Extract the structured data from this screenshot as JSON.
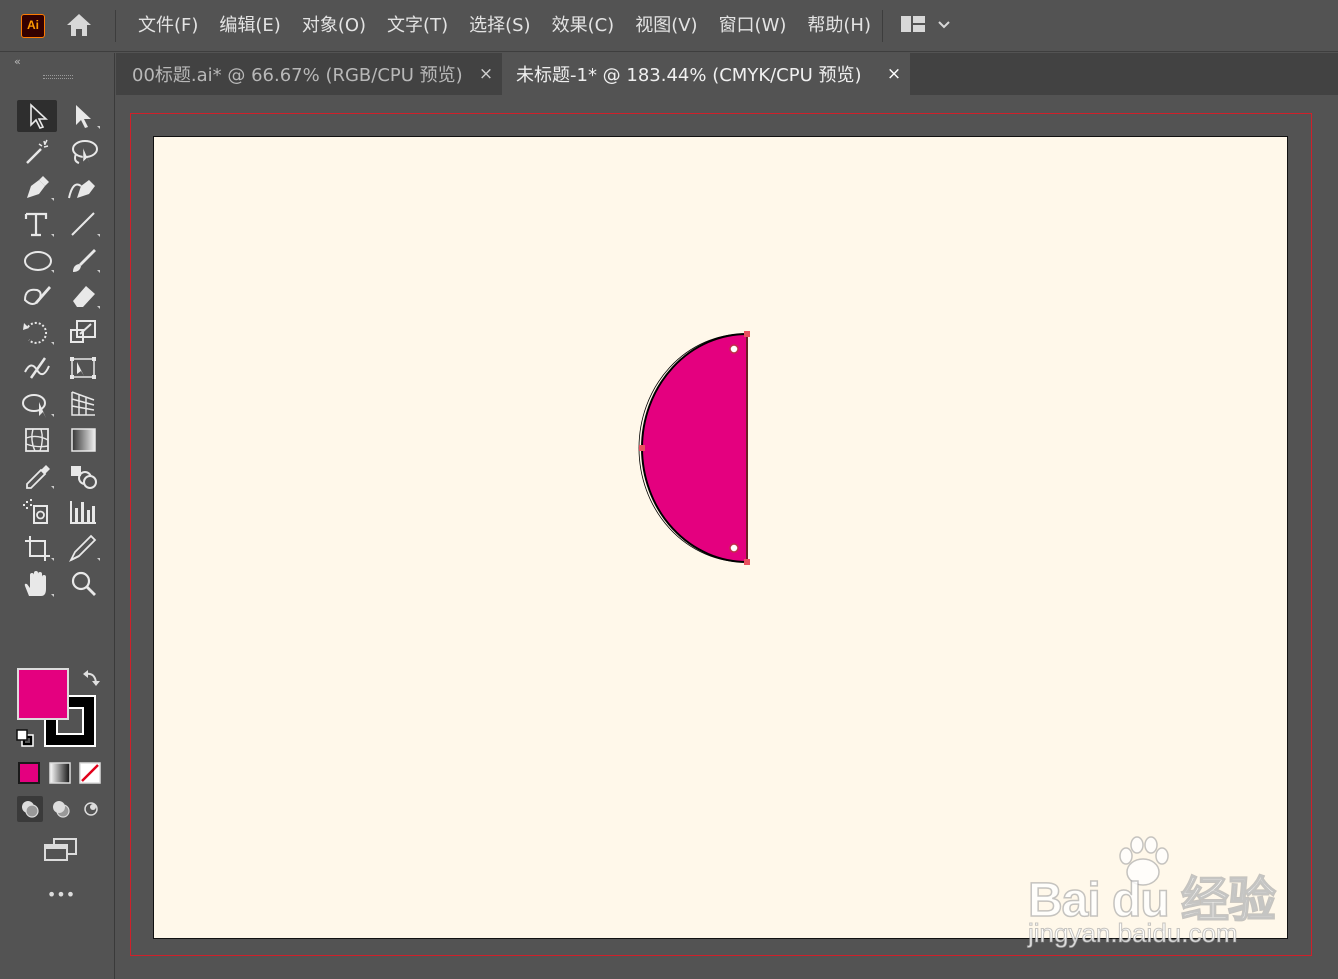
{
  "app": {
    "logo_text": "Ai",
    "menu": [
      "文件(F)",
      "编辑(E)",
      "对象(O)",
      "文字(T)",
      "选择(S)",
      "效果(C)",
      "视图(V)",
      "窗口(W)",
      "帮助(H)"
    ]
  },
  "tabs": [
    {
      "label": "00标题.ai* @ 66.67% (RGB/CPU 预览)",
      "close": "×",
      "active": false
    },
    {
      "label": "未标题-1* @ 183.44% (CMYK/CPU 预览)",
      "close": "×",
      "active": true
    }
  ],
  "toolbar": {
    "collapse": "‹‹",
    "more": "•••",
    "fill_color": "#e4007f",
    "stroke_color": "#000000"
  },
  "artwork": {
    "shape": "half-circle",
    "fill": "#e4007f",
    "stroke": "#000000",
    "artboard_color": "#fff8ea",
    "bleed_color": "#d0202a"
  },
  "watermark": {
    "logo": "Bai du 经验",
    "url": "jingyan.baidu.com"
  }
}
